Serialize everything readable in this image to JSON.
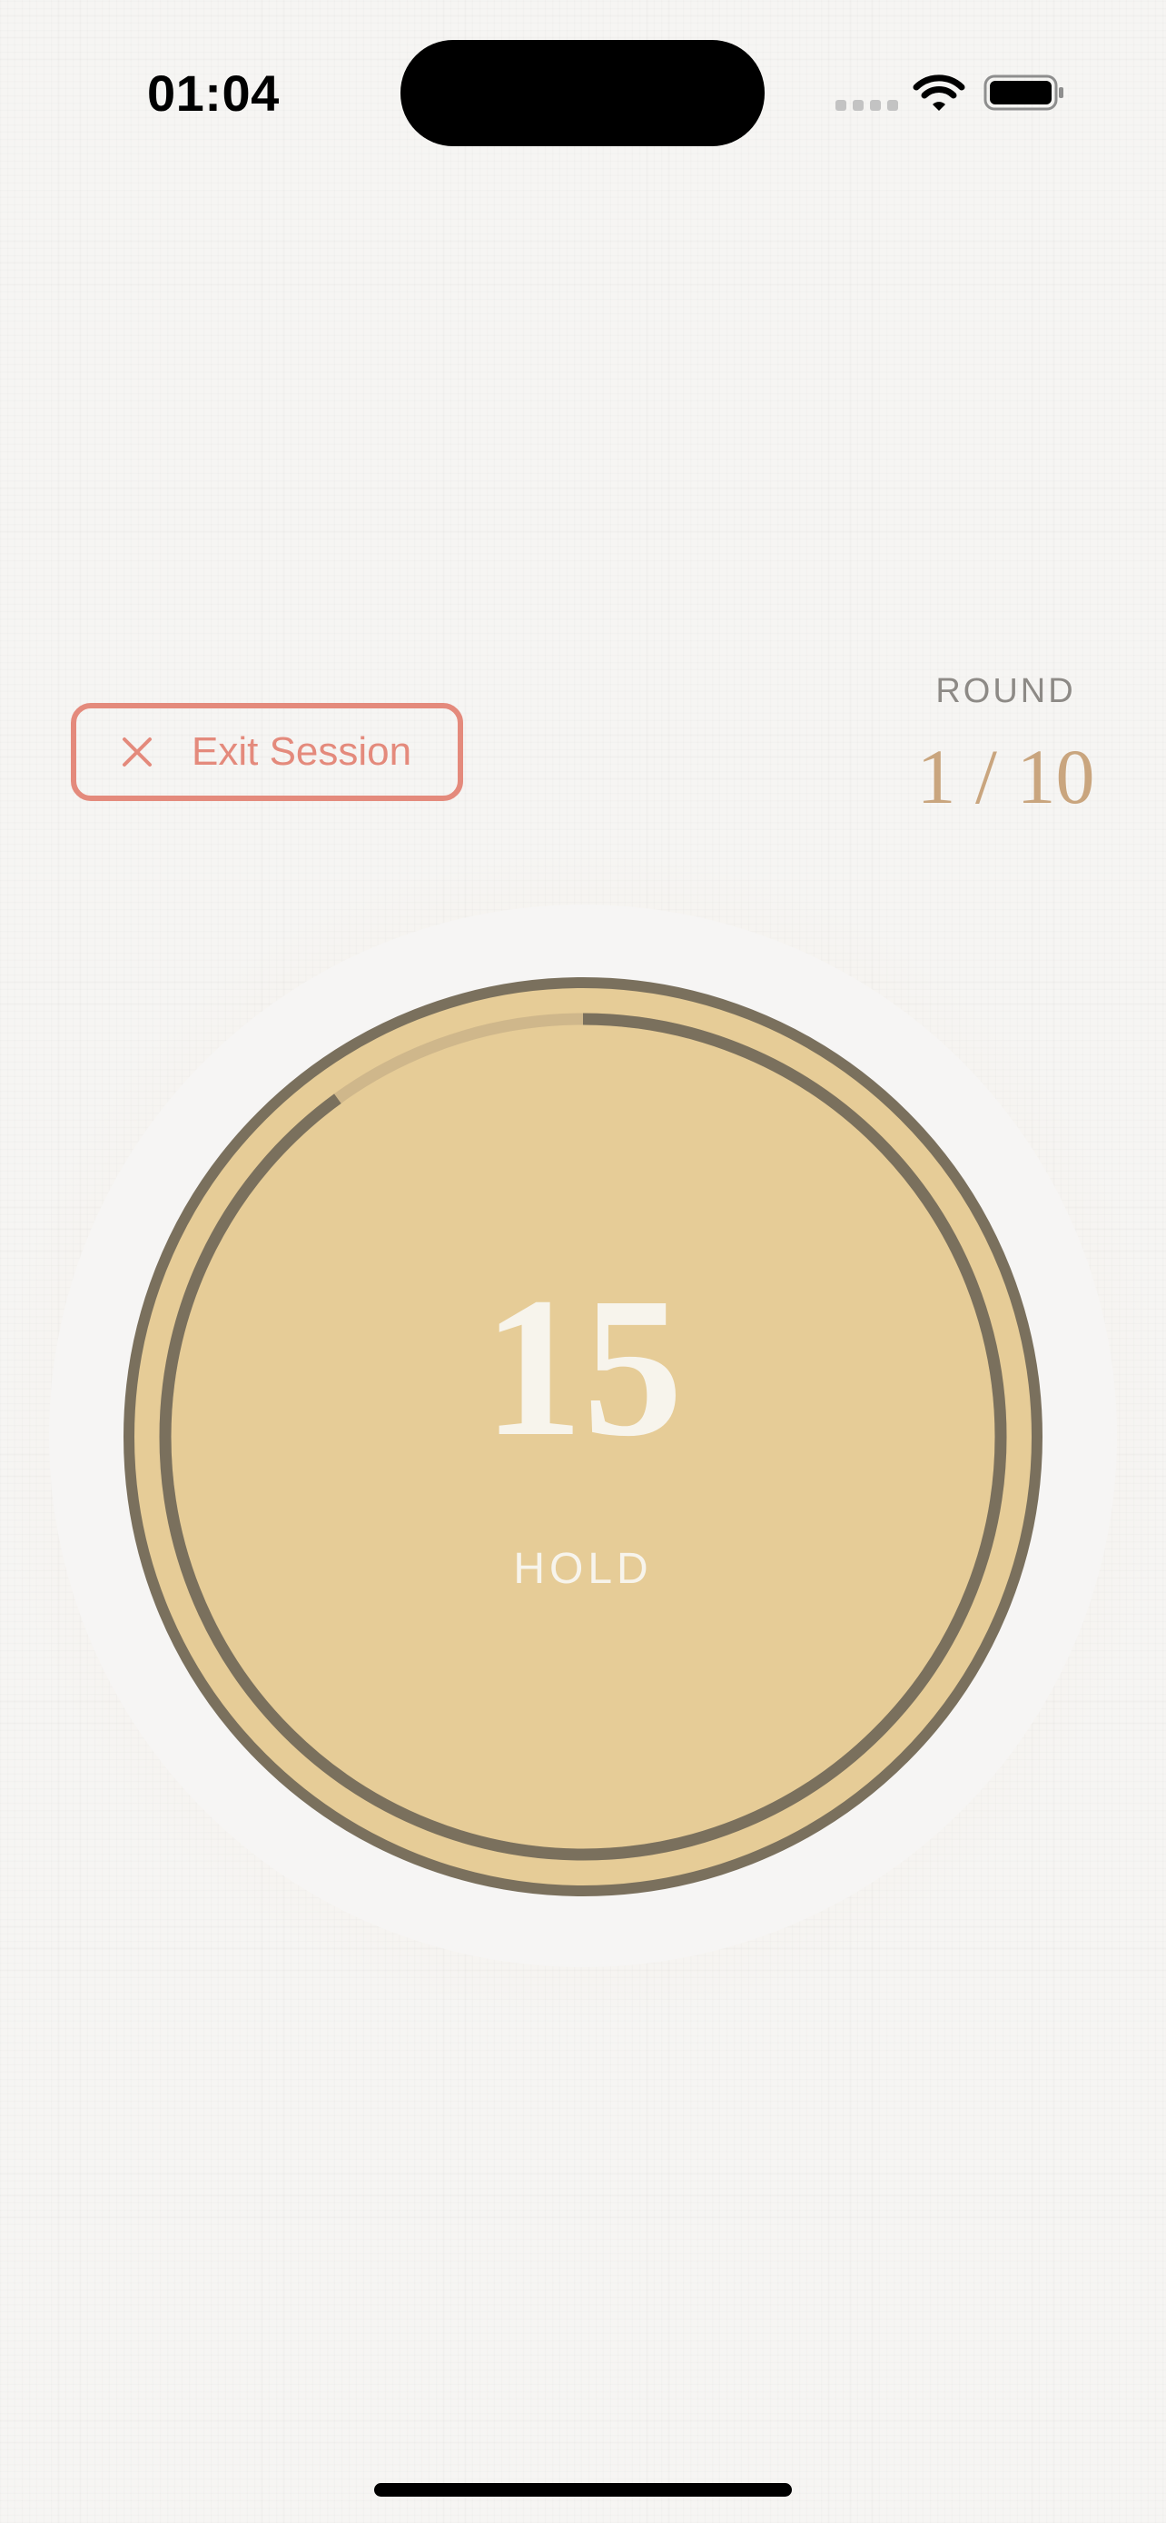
{
  "status_bar": {
    "time": "01:04",
    "signal_icon": "signal-icon",
    "wifi_icon": "wifi-icon",
    "battery_icon": "battery-icon"
  },
  "header": {
    "exit_button": {
      "label": "Exit Session",
      "icon": "close-icon"
    },
    "round": {
      "label": "ROUND",
      "value": "1 / 10"
    }
  },
  "timer": {
    "number": "15",
    "phase": "HOLD",
    "progress_fraction": 0.9
  },
  "colors": {
    "background": "#f6f5f3",
    "accent_coral": "#e48a7c",
    "round_value": "#c9a57e",
    "timer_fill": "#e6cc97",
    "ring_dark": "#7a705d",
    "ring_track": "#cfb78b",
    "timer_text": "#f7f4ec"
  }
}
